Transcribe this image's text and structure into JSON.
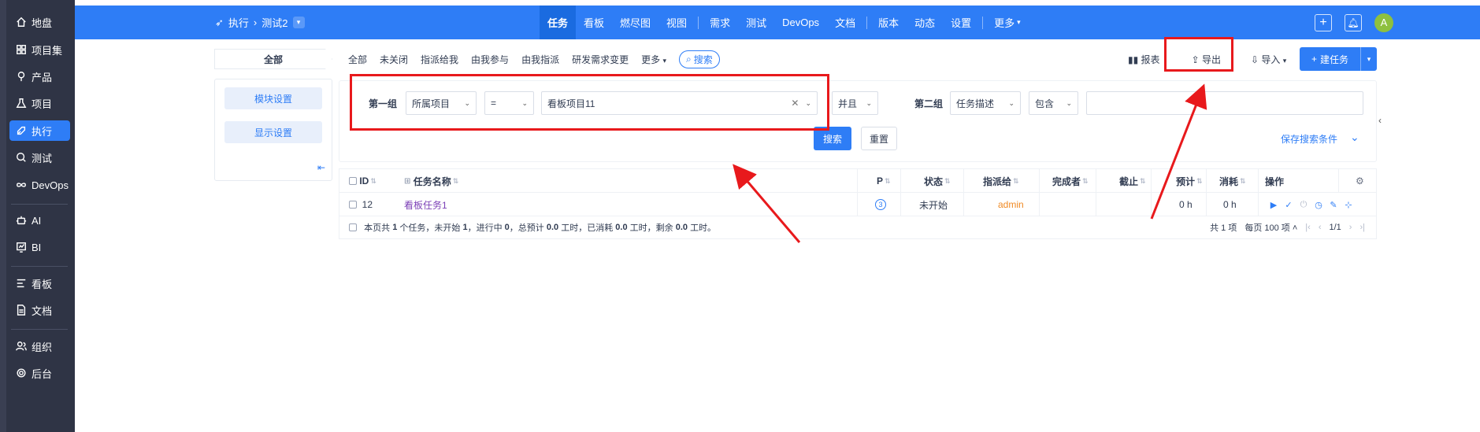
{
  "sidebar": {
    "items": [
      {
        "label": "地盘",
        "icon": "home-icon"
      },
      {
        "label": "项目集",
        "icon": "grid-icon"
      },
      {
        "label": "产品",
        "icon": "pin-icon"
      },
      {
        "label": "项目",
        "icon": "flask-icon"
      },
      {
        "label": "执行",
        "icon": "rocket-icon",
        "active": true
      },
      {
        "label": "测试",
        "icon": "search-icon"
      },
      {
        "label": "DevOps",
        "icon": "infinity-icon"
      },
      {
        "label": "AI",
        "icon": "robot-icon"
      },
      {
        "label": "BI",
        "icon": "chart-icon"
      },
      {
        "label": "看板",
        "icon": "kanban-icon"
      },
      {
        "label": "文档",
        "icon": "doc-icon"
      },
      {
        "label": "组织",
        "icon": "users-icon"
      },
      {
        "label": "后台",
        "icon": "gear-icon"
      }
    ]
  },
  "topbar": {
    "crumb_root": "执行",
    "crumb_current": "测试2",
    "nav": [
      "任务",
      "看板",
      "燃尽图",
      "视图",
      "需求",
      "测试",
      "DevOps",
      "文档",
      "版本",
      "动态",
      "设置",
      "更多"
    ],
    "active": "任务",
    "avatar_letter": "A"
  },
  "left_panel": {
    "all_tab": "全部",
    "module_settings": "模块设置",
    "display_settings": "显示设置"
  },
  "subnav": {
    "items": [
      "全部",
      "未关闭",
      "指派给我",
      "由我参与",
      "由我指派",
      "研发需求变更",
      "更多"
    ],
    "search_label": "搜索"
  },
  "tools": {
    "report": "报表",
    "export": "导出",
    "import": "导入",
    "create": "建任务"
  },
  "search": {
    "group1_label": "第一组",
    "group1_field": "所属项目",
    "group1_op": "=",
    "group1_value": "看板项目11",
    "logic": "并且",
    "group2_label": "第二组",
    "group2_field": "任务描述",
    "group2_op": "包含",
    "group2_value": "",
    "search_btn": "搜索",
    "reset_btn": "重置",
    "save_link": "保存搜索条件"
  },
  "table": {
    "headers": {
      "id": "ID",
      "name": "任务名称",
      "pri": "P",
      "status": "状态",
      "assigned": "指派给",
      "finished_by": "完成者",
      "deadline": "截止",
      "estimate": "预计",
      "consumed": "消耗",
      "actions": "操作"
    },
    "rows": [
      {
        "id": "12",
        "name": "看板任务1",
        "pri": "3",
        "status": "未开始",
        "assigned": "admin",
        "finished_by": "",
        "deadline": "",
        "estimate": "0 h",
        "consumed": "0 h"
      }
    ],
    "summary_prefix": "本页共",
    "summary_tasks": "1",
    "summary_mid1": "个任务，未开始",
    "summary_wait": "1",
    "summary_mid2": "，进行中",
    "summary_doing": "0",
    "summary_mid3": "，总预计",
    "summary_est": "0.0",
    "summary_mid4": "工时，已消耗",
    "summary_consumed": "0.0",
    "summary_mid5": "工时，剩余",
    "summary_left": "0.0",
    "summary_end": "工时。",
    "total_text": "共 1 项",
    "per_page_text": "每页 100 项",
    "page_text": "1/1"
  },
  "colors": {
    "primary": "#2e7df6",
    "sidebar_bg": "#2f3445",
    "annotation_red": "#e8191c",
    "assigned_orange": "#f08a24",
    "task_link_purple": "#7b3fb6"
  }
}
